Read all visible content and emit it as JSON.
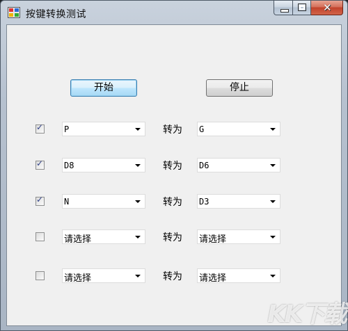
{
  "window": {
    "title": "按键转换测试",
    "controls": {
      "min_icon": "minimize-icon",
      "max_icon": "maximize-icon",
      "close_icon": "close-icon"
    }
  },
  "buttons": {
    "start": "开始",
    "stop": "停止"
  },
  "convert_label": "转为",
  "rows": [
    {
      "checked": true,
      "from": "P",
      "to": "G"
    },
    {
      "checked": true,
      "from": "D8",
      "to": "D6"
    },
    {
      "checked": true,
      "from": "N",
      "to": "D3"
    },
    {
      "checked": false,
      "from": "请选择",
      "to": "请选择"
    },
    {
      "checked": false,
      "from": "请选择",
      "to": "请选择"
    }
  ],
  "watermark": "KK下载"
}
